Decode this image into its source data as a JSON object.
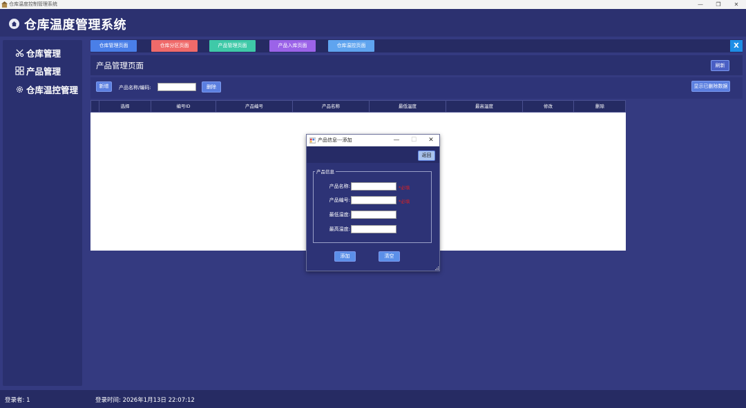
{
  "window": {
    "title": "仓库温度控制管理系统",
    "controls": [
      "—",
      "❐",
      "✕"
    ]
  },
  "header": {
    "app_title": "仓库温度管理系统"
  },
  "sidebar": {
    "items": [
      {
        "label": "仓库管理",
        "icon": "scissors-icon"
      },
      {
        "label": "产品管理",
        "icon": "grid-icon"
      },
      {
        "label": "仓库温控管理",
        "icon": "gear-icon"
      }
    ]
  },
  "tabs": [
    {
      "label": "仓库管理页面",
      "color": "#4a7fe8"
    },
    {
      "label": "仓库分区页面",
      "color": "#f06a6a"
    },
    {
      "label": "产品管理页面",
      "color": "#3fc9a8"
    },
    {
      "label": "产品入库页面",
      "color": "#9b63e8"
    },
    {
      "label": "仓库温控页面",
      "color": "#5fa4ef"
    }
  ],
  "close_button": "X",
  "page": {
    "title": "产品管理页面",
    "refresh_label": "刷新"
  },
  "toolbar": {
    "add_label": "新增",
    "search_label": "产品名称/编码:",
    "search_value": "",
    "delete_label": "删除",
    "show_deleted_label": "显示已删除数据"
  },
  "table": {
    "columns": [
      "选择",
      "编号ID",
      "产品编号",
      "产品名称",
      "最低温度",
      "最高温度",
      "修改",
      "删除"
    ]
  },
  "dialog": {
    "title": "产品信息---添加",
    "controls": [
      "—",
      "☐",
      "✕"
    ],
    "back_label": "返回",
    "group_label": "产品信息",
    "fields": [
      {
        "label": "产品名称:",
        "value": "",
        "required": "*必填"
      },
      {
        "label": "产品编号:",
        "value": "",
        "required": "*必填"
      },
      {
        "label": "最低温度:",
        "value": ""
      },
      {
        "label": "最高温度:",
        "value": ""
      }
    ],
    "add_label": "添加",
    "clear_label": "清空"
  },
  "status": {
    "user": "登录者: 1",
    "login_time": "登录时间: 2026年1月13日 22:07:12"
  }
}
